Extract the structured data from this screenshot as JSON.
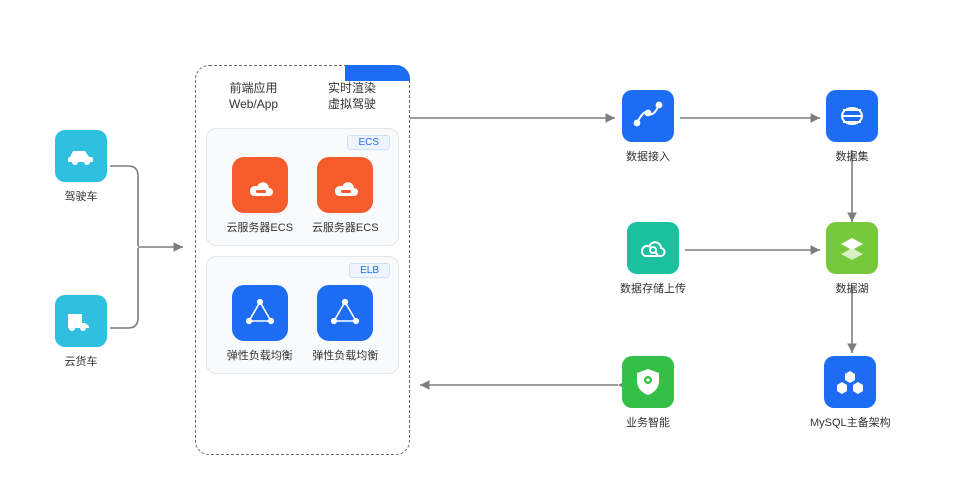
{
  "left": {
    "car_label": "驾驶车",
    "truck_label": "云货车"
  },
  "center": {
    "header_col1_line1": "前端应用",
    "header_col1_line2": "Web/App",
    "header_col2_line1": "实时渲染",
    "header_col2_line2": "虚拟驾驶",
    "ecs_tag": "ECS",
    "ecs_label_a": "云服务器ECS",
    "ecs_label_b": "云服务器ECS",
    "elb_tag": "ELB",
    "elb_label_a": "弹性负载均衡",
    "elb_label_b": "弹性负载均衡"
  },
  "right": {
    "flow_label": "数据接入",
    "dataset_label": "数据集",
    "storage_label": "数据存储上传",
    "lake_label": "数据湖",
    "shield_label": "业务智能",
    "mysql_label": "MySQL主备架构"
  }
}
